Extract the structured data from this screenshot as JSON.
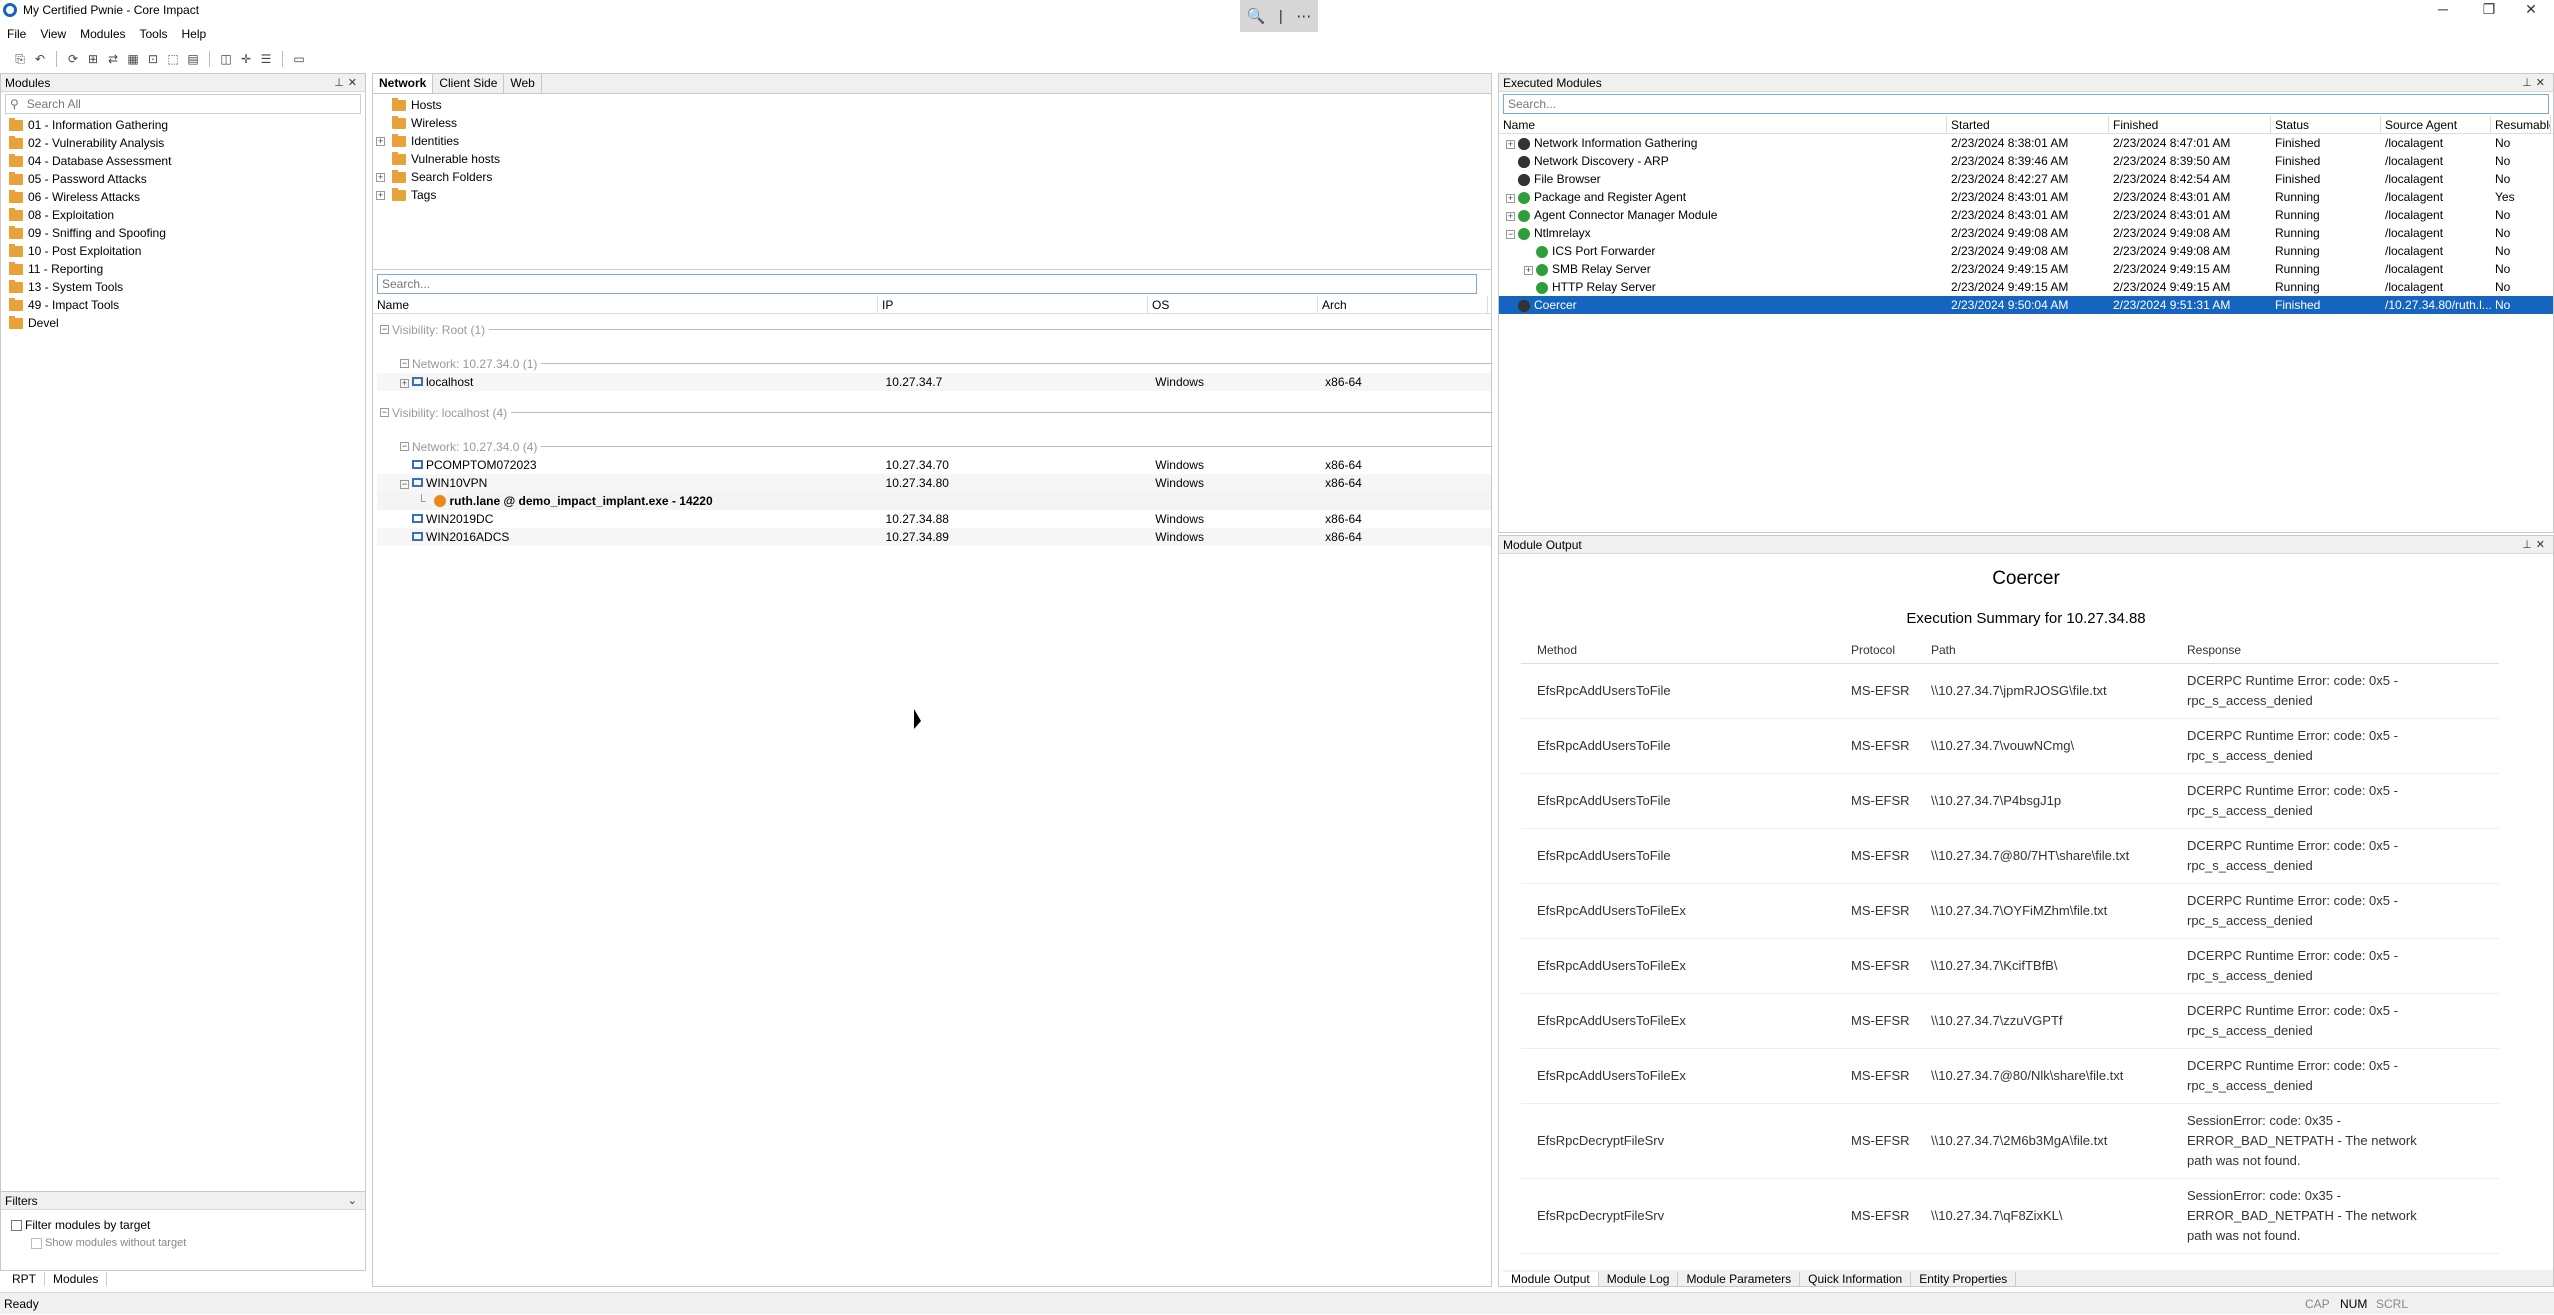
{
  "window": {
    "title": "My Certified Pwnie - Core Impact"
  },
  "menu": [
    "File",
    "View",
    "Modules",
    "Tools",
    "Help"
  ],
  "modules_panel": {
    "title": "Modules",
    "search_placeholder": "Search All",
    "items": [
      "01 - Information Gathering",
      "02 - Vulnerability Analysis",
      "04 - Database Assessment",
      "05 - Password Attacks",
      "06 - Wireless Attacks",
      "08 - Exploitation",
      "09 - Sniffing and Spoofing",
      "10 - Post Exploitation",
      "11 - Reporting",
      "13 - System Tools",
      "49 - Impact Tools",
      "Devel"
    ]
  },
  "filters": {
    "title": "Filters",
    "filter_label": "Filter modules by target",
    "show_label": "Show modules without target"
  },
  "left_tabs": [
    "RPT",
    "Modules"
  ],
  "network": {
    "tabs": [
      "Network",
      "Client Side",
      "Web"
    ],
    "tree": [
      "Hosts",
      "Wireless",
      "Identities",
      "Vulnerable hosts",
      "Search Folders",
      "Tags"
    ],
    "search_placeholder": "Search...",
    "columns": [
      "Name",
      "IP",
      "OS",
      "Arch"
    ],
    "groups": {
      "g1": "Visibility: Root (1)",
      "g1n": "Network: 10.27.34.0 (1)",
      "g2": "Visibility: localhost (4)",
      "g2n": "Network: 10.27.34.0 (4)"
    },
    "hosts": [
      {
        "name": "localhost",
        "ip": "10.27.34.7",
        "os": "Windows",
        "arch": "x86-64"
      },
      {
        "name": "PCOMPTOM072023",
        "ip": "10.27.34.70",
        "os": "Windows",
        "arch": "x86-64"
      },
      {
        "name": "WIN10VPN",
        "ip": "10.27.34.80",
        "os": "Windows",
        "arch": "x86-64"
      },
      {
        "name": "WIN2019DC",
        "ip": "10.27.34.88",
        "os": "Windows",
        "arch": "x86-64"
      },
      {
        "name": "WIN2016ADCS",
        "ip": "10.27.34.89",
        "os": "Windows",
        "arch": "x86-64"
      }
    ],
    "agent": "ruth.lane @ demo_impact_implant.exe - 14220"
  },
  "executed": {
    "title": "Executed Modules",
    "search_placeholder": "Search...",
    "columns": [
      "Name",
      "Started",
      "Finished",
      "Status",
      "Source Agent",
      "Resumable"
    ],
    "rows": [
      {
        "name": "Network Information Gathering",
        "started": "2/23/2024 8:38:01 AM",
        "finished": "2/23/2024 8:47:01 AM",
        "status": "Finished",
        "agent": "/localagent",
        "res": "No"
      },
      {
        "name": "Network Discovery - ARP",
        "started": "2/23/2024 8:39:46 AM",
        "finished": "2/23/2024 8:39:50 AM",
        "status": "Finished",
        "agent": "/localagent",
        "res": "No"
      },
      {
        "name": "File Browser",
        "started": "2/23/2024 8:42:27 AM",
        "finished": "2/23/2024 8:42:54 AM",
        "status": "Finished",
        "agent": "/localagent",
        "res": "No"
      },
      {
        "name": "Package and Register Agent",
        "started": "2/23/2024 8:43:01 AM",
        "finished": "2/23/2024 8:43:01 AM",
        "status": "Running",
        "agent": "/localagent",
        "res": "Yes"
      },
      {
        "name": "Agent Connector Manager Module",
        "started": "2/23/2024 8:43:01 AM",
        "finished": "2/23/2024 8:43:01 AM",
        "status": "Running",
        "agent": "/localagent",
        "res": "No"
      },
      {
        "name": "Ntlmrelayx",
        "started": "2/23/2024 9:49:08 AM",
        "finished": "2/23/2024 9:49:08 AM",
        "status": "Running",
        "agent": "/localagent",
        "res": "No"
      },
      {
        "name": "ICS Port Forwarder",
        "started": "2/23/2024 9:49:08 AM",
        "finished": "2/23/2024 9:49:08 AM",
        "status": "Running",
        "agent": "/localagent",
        "res": "No"
      },
      {
        "name": "SMB Relay Server",
        "started": "2/23/2024 9:49:15 AM",
        "finished": "2/23/2024 9:49:15 AM",
        "status": "Running",
        "agent": "/localagent",
        "res": "No"
      },
      {
        "name": "HTTP Relay Server",
        "started": "2/23/2024 9:49:15 AM",
        "finished": "2/23/2024 9:49:15 AM",
        "status": "Running",
        "agent": "/localagent",
        "res": "No"
      },
      {
        "name": "Coercer",
        "started": "2/23/2024 9:50:04 AM",
        "finished": "2/23/2024 9:51:31 AM",
        "status": "Finished",
        "agent": "/10.27.34.80/ruth.l...",
        "res": "No"
      }
    ]
  },
  "output": {
    "title": "Module Output",
    "heading": "Coercer",
    "summary": "Execution Summary for 10.27.34.88",
    "columns": [
      "Method",
      "Protocol",
      "Path",
      "Response"
    ],
    "rows": [
      {
        "m": "EfsRpcAddUsersToFile",
        "p": "MS-EFSR",
        "path": "\\\\10.27.34.7\\jpmRJOSG\\file.txt",
        "r": "DCERPC Runtime Error: code: 0x5 - rpc_s_access_denied"
      },
      {
        "m": "EfsRpcAddUsersToFile",
        "p": "MS-EFSR",
        "path": "\\\\10.27.34.7\\vouwNCmg\\",
        "r": "DCERPC Runtime Error: code: 0x5 - rpc_s_access_denied"
      },
      {
        "m": "EfsRpcAddUsersToFile",
        "p": "MS-EFSR",
        "path": "\\\\10.27.34.7\\P4bsgJ1p",
        "r": "DCERPC Runtime Error: code: 0x5 - rpc_s_access_denied"
      },
      {
        "m": "EfsRpcAddUsersToFile",
        "p": "MS-EFSR",
        "path": "\\\\10.27.34.7@80/7HT\\share\\file.txt",
        "r": "DCERPC Runtime Error: code: 0x5 - rpc_s_access_denied"
      },
      {
        "m": "EfsRpcAddUsersToFileEx",
        "p": "MS-EFSR",
        "path": "\\\\10.27.34.7\\OYFiMZhm\\file.txt",
        "r": "DCERPC Runtime Error: code: 0x5 - rpc_s_access_denied"
      },
      {
        "m": "EfsRpcAddUsersToFileEx",
        "p": "MS-EFSR",
        "path": "\\\\10.27.34.7\\KcifTBfB\\",
        "r": "DCERPC Runtime Error: code: 0x5 - rpc_s_access_denied"
      },
      {
        "m": "EfsRpcAddUsersToFileEx",
        "p": "MS-EFSR",
        "path": "\\\\10.27.34.7\\zzuVGPTf",
        "r": "DCERPC Runtime Error: code: 0x5 - rpc_s_access_denied"
      },
      {
        "m": "EfsRpcAddUsersToFileEx",
        "p": "MS-EFSR",
        "path": "\\\\10.27.34.7@80/Nlk\\share\\file.txt",
        "r": "DCERPC Runtime Error: code: 0x5 - rpc_s_access_denied"
      },
      {
        "m": "EfsRpcDecryptFileSrv",
        "p": "MS-EFSR",
        "path": "\\\\10.27.34.7\\2M6b3MgA\\file.txt",
        "r": "SessionError: code: 0x35 - ERROR_BAD_NETPATH - The network path was not found."
      },
      {
        "m": "EfsRpcDecryptFileSrv",
        "p": "MS-EFSR",
        "path": "\\\\10.27.34.7\\qF8ZixKL\\",
        "r": "SessionError: code: 0x35 - ERROR_BAD_NETPATH - The network path was not found."
      },
      {
        "m": "",
        "p": "",
        "path": "",
        "r": "SessionError: code: 0x35 -"
      }
    ]
  },
  "bottom_tabs": [
    "Module Output",
    "Module Log",
    "Module Parameters",
    "Quick Information",
    "Entity Properties"
  ],
  "status": {
    "text": "Ready",
    "cap": "CAP",
    "num": "NUM",
    "scrl": "SCRL"
  }
}
